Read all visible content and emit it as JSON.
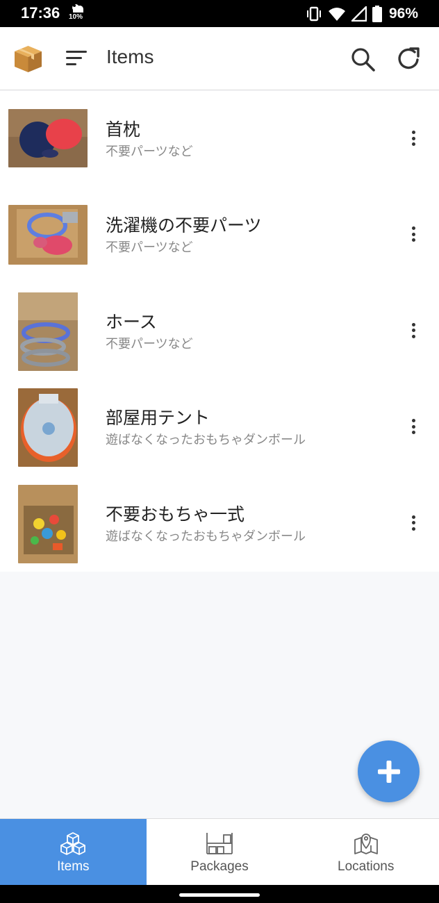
{
  "status_bar": {
    "time": "17:36",
    "weather_temp": "10%",
    "battery_percent": "96%",
    "icons": [
      "weather-icon",
      "vibrate-icon",
      "wifi-icon",
      "signal-icon",
      "battery-icon"
    ]
  },
  "toolbar": {
    "title": "Items",
    "logo_icon": "package-box-icon",
    "menu_icon": "sort-menu-icon",
    "search_icon": "search-icon",
    "refresh_icon": "refresh-icon"
  },
  "items": [
    {
      "name": "首枕",
      "subtitle": "不要パーツなど",
      "thumb_icon": "pillow-photo"
    },
    {
      "name": "洗濯機の不要パーツ",
      "subtitle": "不要パーツなど",
      "thumb_icon": "box-parts-photo"
    },
    {
      "name": "ホース",
      "subtitle": "不要パーツなど",
      "thumb_icon": "hose-photo"
    },
    {
      "name": "部屋用テント",
      "subtitle": "遊ばなくなったおもちゃダンボール",
      "thumb_icon": "tent-photo"
    },
    {
      "name": "不要おもちゃ一式",
      "subtitle": "遊ばなくなったおもちゃダンボール",
      "thumb_icon": "toys-photo"
    }
  ],
  "fab": {
    "icon": "plus-icon"
  },
  "bottom_nav": {
    "active": "Items",
    "tabs": [
      {
        "label": "Items",
        "icon": "cubes-icon"
      },
      {
        "label": "Packages",
        "icon": "shelf-icon"
      },
      {
        "label": "Locations",
        "icon": "map-pin-icon"
      }
    ]
  },
  "colors": {
    "accent": "#4a90e2",
    "background": "#f7f8fa",
    "text_primary": "#222222",
    "text_secondary": "#888888"
  }
}
